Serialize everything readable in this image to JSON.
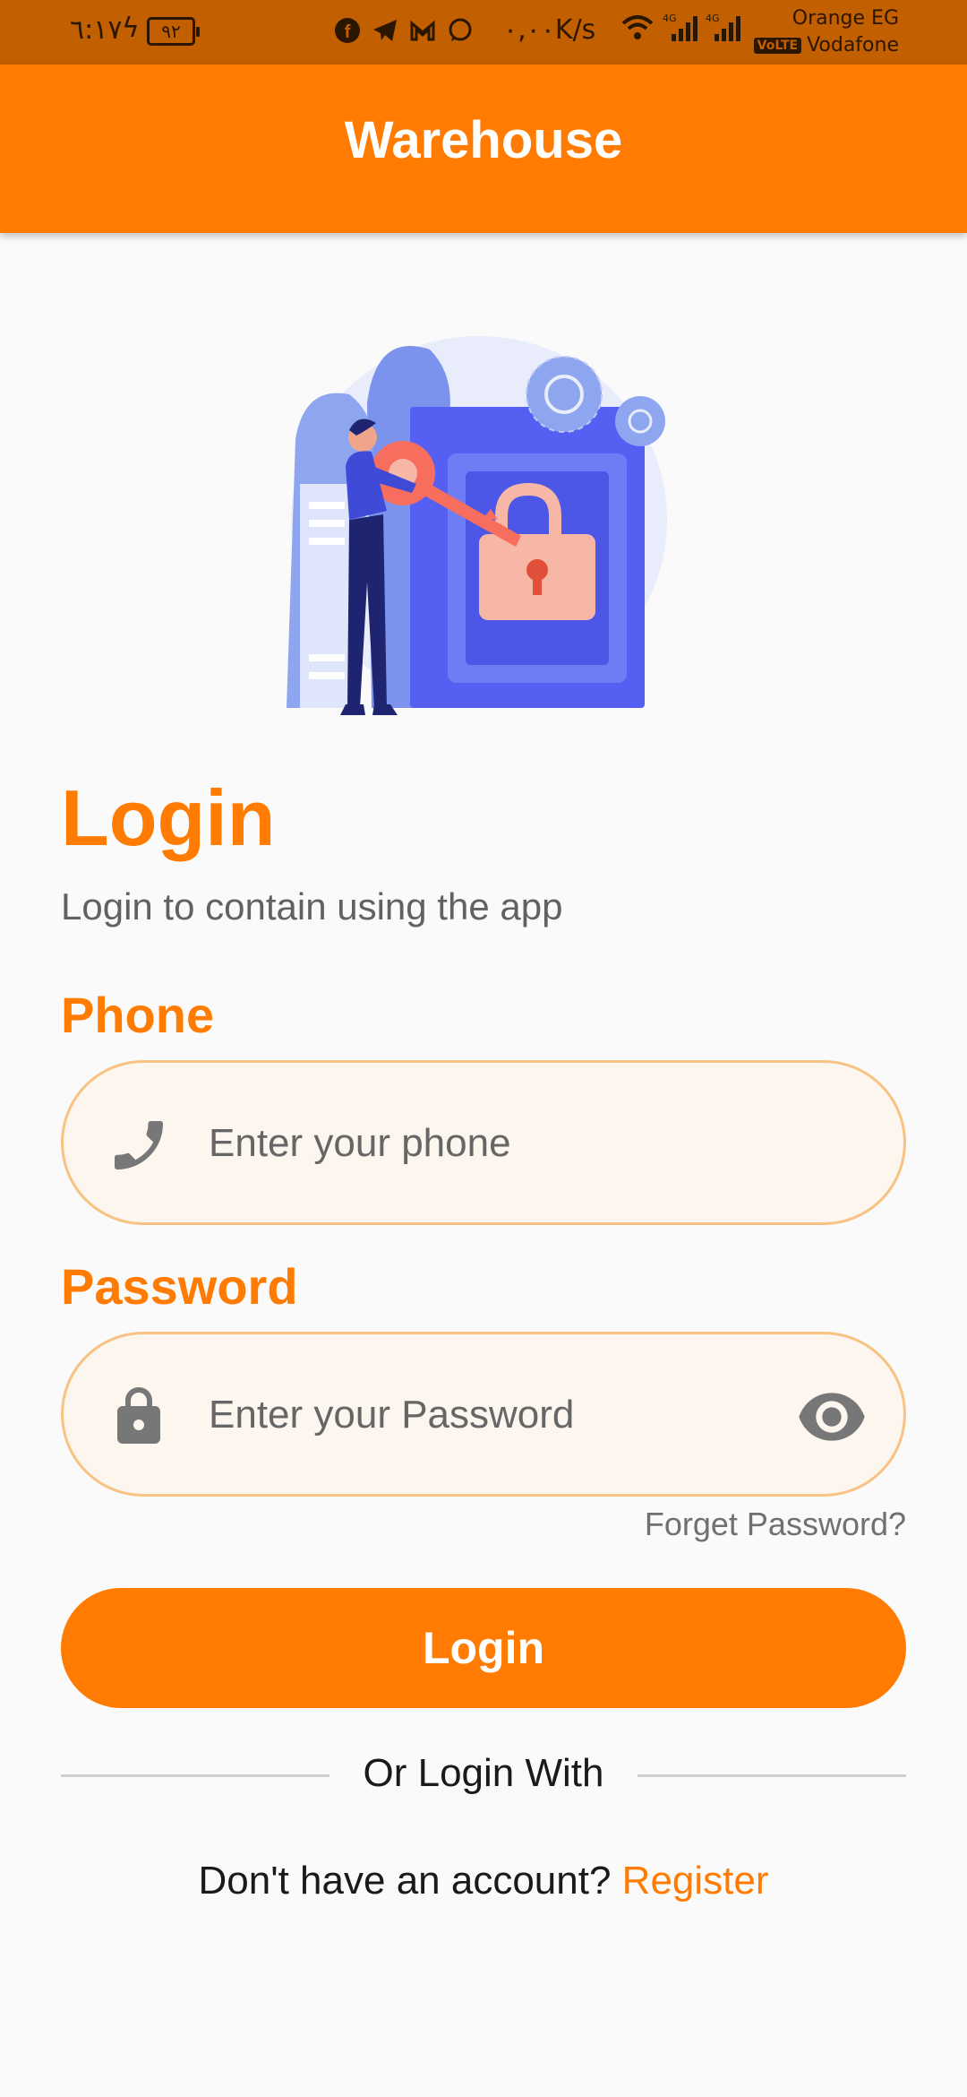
{
  "status_bar": {
    "time": "٦:١٧",
    "battery": "٩٢",
    "speed": "٠,٠٠K/s",
    "network_1": "4G",
    "network_2": "4G",
    "carrier_1": "Orange EG",
    "carrier_2": "Vodafone",
    "volte": "VoLTE",
    "app_icons": [
      "facebook-icon",
      "telegram-icon",
      "gmail-icon",
      "whatsapp-icon"
    ]
  },
  "app_bar": {
    "title": "Warehouse"
  },
  "login": {
    "heading": "Login",
    "subheading": "Login to contain using the app",
    "phone_label": "Phone",
    "phone_placeholder": "Enter your phone",
    "password_label": "Password",
    "password_placeholder": "Enter your Password",
    "forget_password": "Forget Password?",
    "login_button": "Login",
    "or_login_with": "Or Login With",
    "no_account": "Don't have an account?",
    "register": "Register"
  },
  "colors": {
    "accent": "#ff7b02",
    "status_bar": "#c25f00",
    "input_bg": "#fcf6ee",
    "input_border": "#f7c282"
  }
}
